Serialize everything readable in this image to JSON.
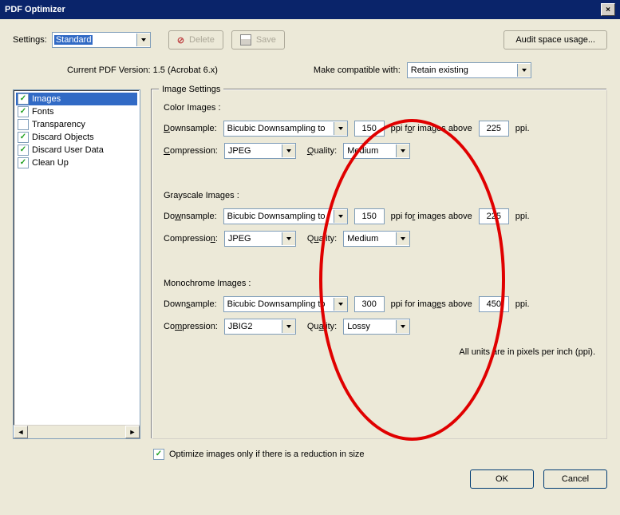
{
  "window": {
    "title": "PDF Optimizer"
  },
  "toolbar": {
    "settings_label": "Settings:",
    "settings_value": "Standard",
    "delete_label": "Delete",
    "save_label": "Save",
    "audit_label": "Audit space usage..."
  },
  "version": {
    "current_label": "Current PDF Version: 1.5 (Acrobat 6.x)",
    "make_compat_label": "Make compatible with:",
    "make_compat_value": "Retain existing"
  },
  "sidebar": {
    "items": [
      {
        "label": "Images",
        "checked": true,
        "selected": true
      },
      {
        "label": "Fonts",
        "checked": true,
        "selected": false
      },
      {
        "label": "Transparency",
        "checked": false,
        "selected": false
      },
      {
        "label": "Discard Objects",
        "checked": true,
        "selected": false
      },
      {
        "label": "Discard User Data",
        "checked": true,
        "selected": false
      },
      {
        "label": "Clean Up",
        "checked": true,
        "selected": false
      }
    ]
  },
  "image_settings": {
    "legend": "Image Settings",
    "labels": {
      "downsample": "Downsample:",
      "compression": "Compression:",
      "quality": "Quality:",
      "ppi_for": "ppi for images above",
      "ppi": "ppi."
    },
    "color": {
      "title": "Color Images :",
      "downsample_method": "Bicubic Downsampling to",
      "ppi": "150",
      "above": "225",
      "compression": "JPEG",
      "quality": "Medium"
    },
    "gray": {
      "title": "Grayscale Images :",
      "downsample_method": "Bicubic Downsampling to",
      "ppi": "150",
      "above": "225",
      "compression": "JPEG",
      "quality": "Medium"
    },
    "mono": {
      "title": "Monochrome Images :",
      "downsample_method": "Bicubic Downsampling to",
      "ppi": "300",
      "above": "450",
      "compression": "JBIG2",
      "quality": "Lossy"
    },
    "note": "All units are in pixels per inch (ppi).",
    "optimize_reduction": "Optimize images only if there is a reduction in size"
  },
  "buttons": {
    "ok": "OK",
    "cancel": "Cancel"
  }
}
